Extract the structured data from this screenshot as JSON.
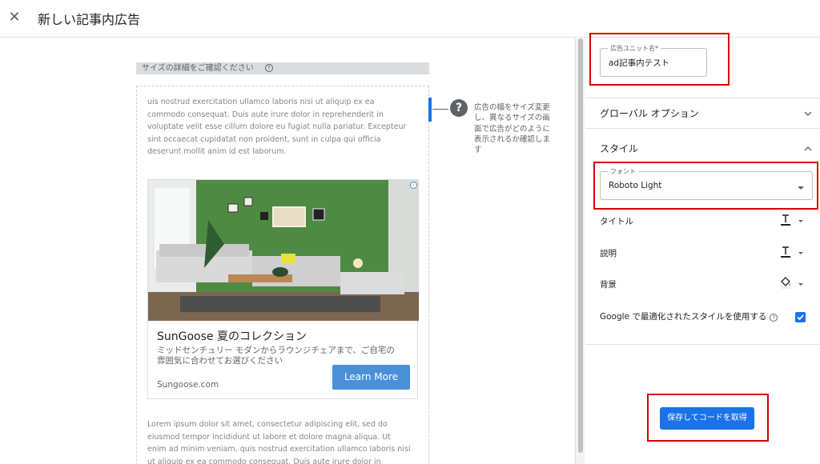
{
  "header": {
    "close_label": "✕",
    "title": "新しい記事内広告"
  },
  "preview": {
    "size_bar_label": "サイズの詳細をご確認ください",
    "size_bar_help": "?",
    "lorem_top": "uis nostrud exercitation ullamco laboris nisi ut aliquip ex ea commodo consequat. Duis aute irure dolor in reprehenderit in voluptate velit esse cillum dolore eu fugiat nulla pariatur. Excepteur sint occaecat cupidatat non proident, sunt in culpa qui officia deserunt mollit anim id est laborum.",
    "lorem_bottom": "Lorem ipsum dolor sit amet, consectetur adipiscing elit, sed do eiusmod tempor incididunt ut labore et dolore magna aliqua. Ut enim ad minim veniam, quis nostrud exercitation ullamco laboris nisi ut aliquip ex ea commodo consequat. Duis aute irure dolor in",
    "hint_icon": "?",
    "hint": "広告の幅をサイズ変更し、異なるサイズの画面で広告がどのように表示されるか確認します",
    "ad": {
      "adchoices": "i",
      "title": "SunGoose 夏のコレクション",
      "description": "ミッドセンチュリー モダンからラウンジチェアまで、ご自宅の雰囲気に合わせてお選びください",
      "url": "Sungoose.com",
      "cta": "Learn More",
      "image": "living-room-photo"
    }
  },
  "panel": {
    "ad_unit_name_label": "広告ユニット名*",
    "ad_unit_name_value": "ad記事内テスト",
    "global_options": "グローバル オプション",
    "style_section": "スタイル",
    "font_label": "フォント",
    "font_value": "Roboto Light",
    "title_row": "タイトル",
    "description_row": "説明",
    "background_row": "背景",
    "google_optimized": "Google で最適化されたスタイルを使用する",
    "google_optimized_checked": true,
    "help": "?",
    "save_button": "保存してコードを取得"
  },
  "colors": {
    "primary": "#1a73e8",
    "cta": "#4a90d9",
    "highlight_box": "#d50000"
  }
}
